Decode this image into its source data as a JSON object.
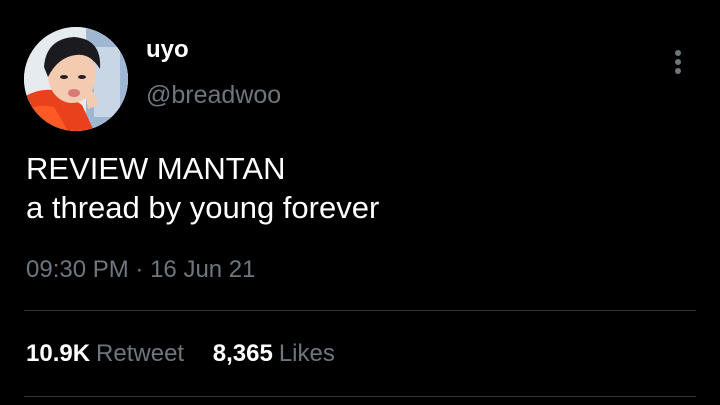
{
  "author": {
    "display_name": "uyo",
    "handle": "@breadwoo",
    "avatar_icon": "profile-photo"
  },
  "tweet": {
    "lines": [
      "REVIEW MANTAN",
      "a thread by young forever"
    ],
    "time": "09:30 PM",
    "separator": "·",
    "date": "16 Jun 21"
  },
  "stats": {
    "retweets_count": "10.9K",
    "retweets_label": "Retweet",
    "likes_count": "8,365",
    "likes_label": "Likes"
  },
  "menu_icon": "more-vertical-icon",
  "colors": {
    "background": "#000000",
    "text": "#ffffff",
    "secondary_text": "#6e767d",
    "divider": "#2f3336"
  }
}
